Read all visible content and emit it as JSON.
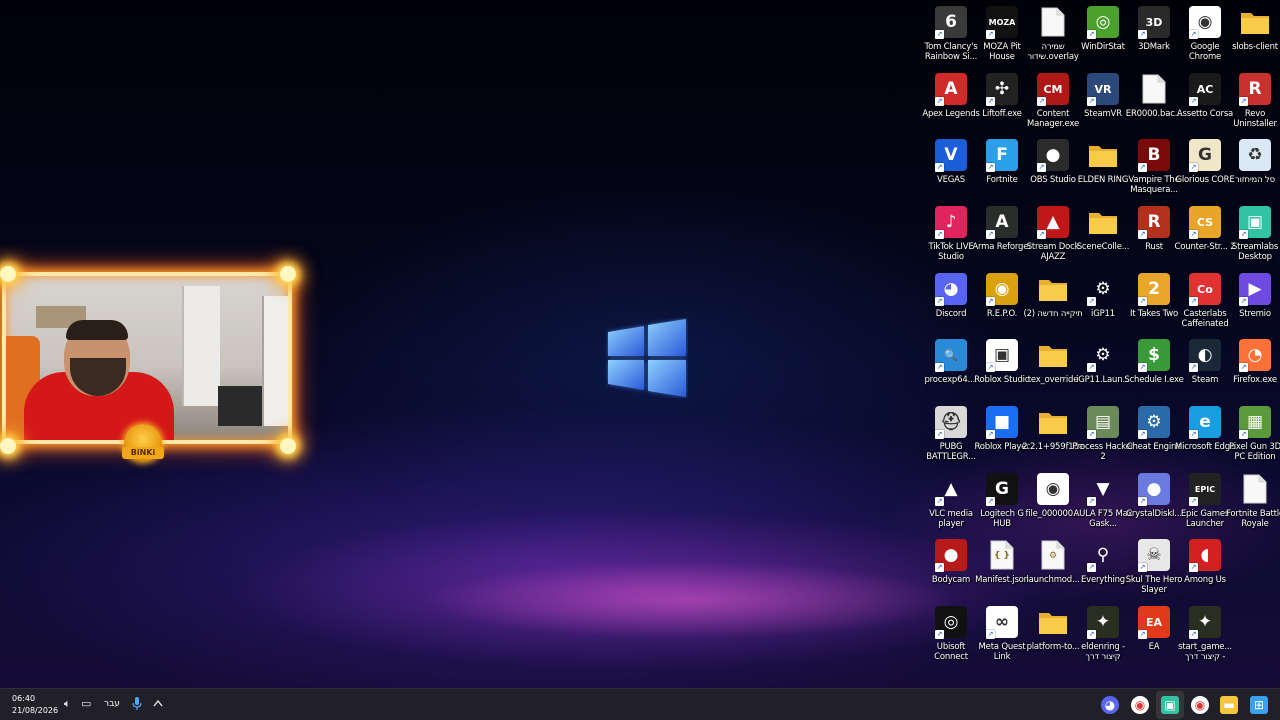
{
  "desktop": {
    "icons": [
      {
        "label": "Tom Clancy's Rainbow Si...",
        "icon": "rainbow-six-siege-icon",
        "color": "#3a3a3a",
        "glyph": "6",
        "col": 0,
        "row": 0,
        "shortcut": true
      },
      {
        "label": "MOZA Pit House",
        "icon": "moza-pit-house-icon",
        "color": "#111111",
        "glyph": "MOZA",
        "col": 1,
        "row": 0,
        "shortcut": true
      },
      {
        "label": "שמירה שידור.overlay",
        "icon": "overlay-file-icon",
        "color": "#f4f4f4",
        "glyph": "",
        "col": 2,
        "row": 0,
        "shortcut": false
      },
      {
        "label": "WinDirStat",
        "icon": "windirstat-icon",
        "color": "#4aa12c",
        "glyph": "◎",
        "col": 3,
        "row": 0,
        "shortcut": true
      },
      {
        "label": "3DMark",
        "icon": "3dmark-icon",
        "color": "#2a2a2a",
        "glyph": "3D",
        "col": 4,
        "row": 0,
        "shortcut": true
      },
      {
        "label": "Google Chrome",
        "icon": "chrome-icon",
        "color": "#ffffff",
        "glyph": "◉",
        "col": 5,
        "row": 0,
        "shortcut": true
      },
      {
        "label": "slobs-client",
        "icon": "folder-icon",
        "color": "#f5c542",
        "glyph": "",
        "col": 6,
        "row": 0,
        "shortcut": false
      },
      {
        "label": "Apex Legends",
        "icon": "apex-legends-icon",
        "color": "#d12a2a",
        "glyph": "A",
        "col": 0,
        "row": 1,
        "shortcut": true
      },
      {
        "label": "Liftoff.exe",
        "icon": "liftoff-icon",
        "color": "#222222",
        "glyph": "✣",
        "col": 1,
        "row": 1,
        "shortcut": true
      },
      {
        "label": "Content Manager.exe",
        "icon": "content-manager-icon",
        "color": "#b01818",
        "glyph": "CM",
        "col": 2,
        "row": 1,
        "shortcut": true
      },
      {
        "label": "SteamVR",
        "icon": "steamvr-icon",
        "color": "#2b4a7a",
        "glyph": "VR",
        "col": 3,
        "row": 1,
        "shortcut": true
      },
      {
        "label": "ER0000.bac...",
        "icon": "file-icon",
        "color": "#f4f4f4",
        "glyph": "",
        "col": 4,
        "row": 1,
        "shortcut": false
      },
      {
        "label": "Assetto Corsa",
        "icon": "assetto-corsa-icon",
        "color": "#1a1a1a",
        "glyph": "AC",
        "col": 5,
        "row": 1,
        "shortcut": true
      },
      {
        "label": "Revo Uninstaller",
        "icon": "revo-uninstaller-icon",
        "color": "#c93030",
        "glyph": "R",
        "col": 6,
        "row": 1,
        "shortcut": true
      },
      {
        "label": "VEGAS",
        "icon": "vegas-icon",
        "color": "#1a5ed8",
        "glyph": "V",
        "col": 0,
        "row": 2,
        "shortcut": true
      },
      {
        "label": "Fortnite",
        "icon": "fortnite-icon",
        "color": "#2aa0e8",
        "glyph": "F",
        "col": 1,
        "row": 2,
        "shortcut": true
      },
      {
        "label": "OBS Studio",
        "icon": "obs-icon",
        "color": "#2b2b2b",
        "glyph": "●",
        "col": 2,
        "row": 2,
        "shortcut": true
      },
      {
        "label": "ELDEN RING",
        "icon": "folder-icon",
        "color": "#f5c542",
        "glyph": "",
        "col": 3,
        "row": 2,
        "shortcut": false
      },
      {
        "label": "Vampire The Masquera...",
        "icon": "vampire-icon",
        "color": "#7a0a0a",
        "glyph": "B",
        "col": 4,
        "row": 2,
        "shortcut": true
      },
      {
        "label": "Glorious CORE",
        "icon": "glorious-core-icon",
        "color": "#f0e6c8",
        "glyph": "G",
        "col": 5,
        "row": 2,
        "shortcut": true
      },
      {
        "label": "סל המיחזור",
        "icon": "recycle-bin-icon",
        "color": "#dbe8f5",
        "glyph": "♻",
        "col": 6,
        "row": 2,
        "shortcut": false
      },
      {
        "label": "TikTok LIVE Studio",
        "icon": "tiktok-live-icon",
        "color": "#e0245e",
        "glyph": "♪",
        "col": 0,
        "row": 3,
        "shortcut": true
      },
      {
        "label": "Arma Reforger",
        "icon": "arma-reforger-icon",
        "color": "#2a2e2a",
        "glyph": "A",
        "col": 1,
        "row": 3,
        "shortcut": true
      },
      {
        "label": "Stream Dock AJAZZ",
        "icon": "stream-dock-icon",
        "color": "#c01818",
        "glyph": "▲",
        "col": 2,
        "row": 3,
        "shortcut": true
      },
      {
        "label": "SceneColle...",
        "icon": "folder-icon",
        "color": "#f5c542",
        "glyph": "",
        "col": 3,
        "row": 3,
        "shortcut": false
      },
      {
        "label": "Rust",
        "icon": "rust-icon",
        "color": "#b3301d",
        "glyph": "R",
        "col": 4,
        "row": 3,
        "shortcut": true
      },
      {
        "label": "Counter-Str... 2",
        "icon": "counter-strike-icon",
        "color": "#e8a52a",
        "glyph": "CS",
        "col": 5,
        "row": 3,
        "shortcut": true
      },
      {
        "label": "Streamlabs Desktop",
        "icon": "streamlabs-icon",
        "color": "#31c3a2",
        "glyph": "▣",
        "col": 6,
        "row": 3,
        "shortcut": true
      },
      {
        "label": "Discord",
        "icon": "discord-icon",
        "color": "#5865f2",
        "glyph": "◕",
        "col": 0,
        "row": 4,
        "shortcut": true
      },
      {
        "label": "R.E.P.O.",
        "icon": "repo-icon",
        "color": "#d9a10f",
        "glyph": "◉",
        "col": 1,
        "row": 4,
        "shortcut": true
      },
      {
        "label": "תיקייה חדשה (2)",
        "icon": "folder-icon",
        "color": "#f5c542",
        "glyph": "",
        "col": 2,
        "row": 4,
        "shortcut": false
      },
      {
        "label": "iGP11",
        "icon": "gear-icon",
        "color": "transparent",
        "glyph": "⚙",
        "col": 3,
        "row": 4,
        "shortcut": true
      },
      {
        "label": "It Takes Two",
        "icon": "it-takes-two-icon",
        "color": "#e8a62a",
        "glyph": "2",
        "col": 4,
        "row": 4,
        "shortcut": true
      },
      {
        "label": "Casterlabs Caffeinated",
        "icon": "casterlabs-icon",
        "color": "#e03232",
        "glyph": "Co",
        "col": 5,
        "row": 4,
        "shortcut": true
      },
      {
        "label": "Stremio",
        "icon": "stremio-icon",
        "color": "#6e4ae0",
        "glyph": "▶",
        "col": 6,
        "row": 4,
        "shortcut": true
      },
      {
        "label": "procexp64....",
        "icon": "process-explorer-icon",
        "color": "#2a8ad8",
        "glyph": "🔍",
        "col": 0,
        "row": 5,
        "shortcut": true
      },
      {
        "label": "Roblox Studio",
        "icon": "roblox-studio-icon",
        "color": "#ffffff",
        "glyph": "▣",
        "col": 1,
        "row": 5,
        "shortcut": true
      },
      {
        "label": "tex_override",
        "icon": "folder-icon",
        "color": "#f5c542",
        "glyph": "",
        "col": 2,
        "row": 5,
        "shortcut": false
      },
      {
        "label": "iGP11.Laun...",
        "icon": "gear-icon",
        "color": "transparent",
        "glyph": "⚙",
        "col": 3,
        "row": 5,
        "shortcut": true
      },
      {
        "label": "Schedule I.exe",
        "icon": "schedule-one-icon",
        "color": "#3a9a3a",
        "glyph": "$",
        "col": 4,
        "row": 5,
        "shortcut": true
      },
      {
        "label": "Steam",
        "icon": "steam-icon",
        "color": "#1b2838",
        "glyph": "◐",
        "col": 5,
        "row": 5,
        "shortcut": true
      },
      {
        "label": "Firefox.exe",
        "icon": "firefox-icon",
        "color": "#ff7139",
        "glyph": "◔",
        "col": 6,
        "row": 5,
        "shortcut": true
      },
      {
        "label": "PUBG BATTLEGR...",
        "icon": "pubg-icon",
        "color": "#d8d8d8",
        "glyph": "⛑",
        "col": 0,
        "row": 6,
        "shortcut": true
      },
      {
        "label": "Roblox Player",
        "icon": "roblox-player-icon",
        "color": "#1a6ef5",
        "glyph": "■",
        "col": 1,
        "row": 6,
        "shortcut": true
      },
      {
        "label": "2.2.1+959f16e",
        "icon": "folder-icon",
        "color": "#f5c542",
        "glyph": "",
        "col": 2,
        "row": 6,
        "shortcut": false
      },
      {
        "label": "Process Hacker 2",
        "icon": "process-hacker-icon",
        "color": "#6a8a5a",
        "glyph": "▤",
        "col": 3,
        "row": 6,
        "shortcut": true
      },
      {
        "label": "Cheat Engine",
        "icon": "cheat-engine-icon",
        "color": "#2a6aa8",
        "glyph": "⚙",
        "col": 4,
        "row": 6,
        "shortcut": true
      },
      {
        "label": "Microsoft Edge",
        "icon": "edge-icon",
        "color": "#1b9de2",
        "glyph": "e",
        "col": 5,
        "row": 6,
        "shortcut": true
      },
      {
        "label": "Pixel Gun 3D PC Edition",
        "icon": "pixel-gun-icon",
        "color": "#5a9a3a",
        "glyph": "▦",
        "col": 6,
        "row": 6,
        "shortcut": true
      },
      {
        "label": "VLC media player",
        "icon": "vlc-icon",
        "color": "transparent",
        "glyph": "▲",
        "col": 0,
        "row": 7,
        "shortcut": true
      },
      {
        "label": "Logitech G HUB",
        "icon": "logitech-ghub-icon",
        "color": "#111111",
        "glyph": "G",
        "col": 1,
        "row": 7,
        "shortcut": true
      },
      {
        "label": "file_000000...",
        "icon": "chrome-file-icon",
        "color": "#ffffff",
        "glyph": "◉",
        "col": 2,
        "row": 7,
        "shortcut": false
      },
      {
        "label": "AULA F75 Max Gask...",
        "icon": "aula-icon",
        "color": "transparent",
        "glyph": "▼",
        "col": 3,
        "row": 7,
        "shortcut": true
      },
      {
        "label": "CrystalDiskI...",
        "icon": "crystaldiskinfo-icon",
        "color": "#6a7adf",
        "glyph": "●",
        "col": 4,
        "row": 7,
        "shortcut": true
      },
      {
        "label": "Epic Games Launcher",
        "icon": "epic-games-icon",
        "color": "#222222",
        "glyph": "EPIC",
        "col": 5,
        "row": 7,
        "shortcut": true
      },
      {
        "label": "Fortnite Battle Royale",
        "icon": "file-icon",
        "color": "#f4f4f4",
        "glyph": "",
        "col": 6,
        "row": 7,
        "shortcut": false
      },
      {
        "label": "Bodycam",
        "icon": "bodycam-icon",
        "color": "#b81a1a",
        "glyph": "●",
        "col": 0,
        "row": 8,
        "shortcut": true
      },
      {
        "label": "Manifest.json",
        "icon": "json-file-icon",
        "color": "#f4f4f4",
        "glyph": "{ }",
        "col": 1,
        "row": 8,
        "shortcut": false
      },
      {
        "label": "launchmod...",
        "icon": "settings-file-icon",
        "color": "#e8e8e8",
        "glyph": "⚙",
        "col": 2,
        "row": 8,
        "shortcut": false
      },
      {
        "label": "Everything",
        "icon": "everything-search-icon",
        "color": "transparent",
        "glyph": "⚲",
        "col": 3,
        "row": 8,
        "shortcut": true
      },
      {
        "label": "Skul The Hero Slayer",
        "icon": "skul-icon",
        "color": "#e8e8e8",
        "glyph": "☠",
        "col": 4,
        "row": 8,
        "shortcut": true
      },
      {
        "label": "Among Us",
        "icon": "among-us-icon",
        "color": "#d32020",
        "glyph": "◖",
        "col": 5,
        "row": 8,
        "shortcut": true
      },
      {
        "label": "Ubisoft Connect",
        "icon": "ubisoft-icon",
        "color": "#111111",
        "glyph": "◎",
        "col": 0,
        "row": 9,
        "shortcut": true
      },
      {
        "label": "Meta Quest Link",
        "icon": "meta-quest-icon",
        "color": "#ffffff",
        "glyph": "∞",
        "col": 1,
        "row": 9,
        "shortcut": true
      },
      {
        "label": "platform-to...",
        "icon": "folder-icon",
        "color": "#f5c542",
        "glyph": "",
        "col": 2,
        "row": 9,
        "shortcut": false
      },
      {
        "label": "eldenring - קיצור דרך",
        "icon": "elden-ring-icon",
        "color": "#2a2e20",
        "glyph": "✦",
        "col": 3,
        "row": 9,
        "shortcut": true
      },
      {
        "label": "EA",
        "icon": "ea-icon",
        "color": "#e03a1a",
        "glyph": "EA",
        "col": 4,
        "row": 9,
        "shortcut": true
      },
      {
        "label": "start_game... קיצור דרך -",
        "icon": "elden-ring-icon",
        "color": "#2a2e20",
        "glyph": "✦",
        "col": 5,
        "row": 9,
        "shortcut": true
      }
    ]
  },
  "webcam": {
    "badge": "BiNKi"
  },
  "taskbar": {
    "time": "06:40",
    "date": "21/08/2026",
    "language": "עבר",
    "tray_icons": [
      "volume-icon",
      "network-icon",
      "microphone-icon",
      "chevron-up-icon"
    ],
    "apps": [
      {
        "name": "discord-taskbar-icon",
        "color": "#5865f2",
        "glyph": "◕"
      },
      {
        "name": "chrome-taskbar-icon",
        "color": "#ffffff",
        "glyph": "◉"
      },
      {
        "name": "streamlabs-taskbar-icon",
        "color": "#31c3a2",
        "glyph": "▣",
        "active": true
      },
      {
        "name": "chrome-taskbar-icon-2",
        "color": "#ffffff",
        "glyph": "◉"
      },
      {
        "name": "file-explorer-taskbar-icon",
        "color": "#f5c542",
        "glyph": "▬"
      },
      {
        "name": "start-button-icon",
        "color": "#3aa0f0",
        "glyph": "⊞"
      }
    ]
  }
}
